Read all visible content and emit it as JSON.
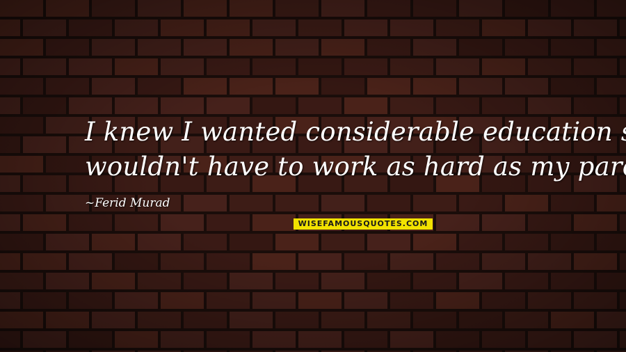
{
  "quote": {
    "line_1": "I knew I wanted considerable education so that I",
    "line_2": "wouldn't have to work as hard as my parents.",
    "author": "~Ferid Murad"
  },
  "watermark": {
    "text": "WISEFAMOUSQUOTES.COM",
    "color": "#f2e200"
  },
  "colors": {
    "text": "#ffffff",
    "brick": "#3d1c16",
    "mortar": "#1a0d0a"
  }
}
